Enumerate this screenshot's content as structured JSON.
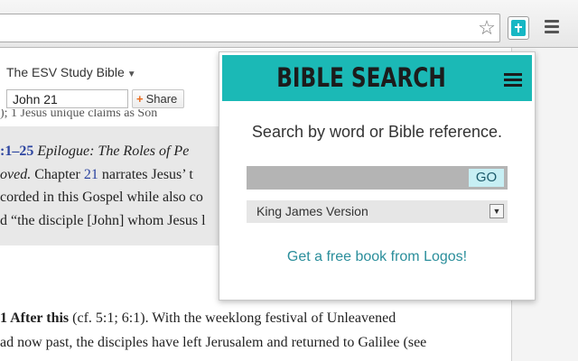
{
  "toolbar": {
    "star_icon": "star-outline-icon",
    "extension_icon": "bible-extension-icon",
    "menu_icon": "hamburger-menu-icon"
  },
  "page": {
    "study_bible": "The ESV Study Bible",
    "reference_value": "John 21",
    "share_label": "Share",
    "cut_line": "); 1   Jesus   unique claims as   Son",
    "lines": [
      {
        "prefix": ":1–25",
        "em": " Epilogue: The Roles of Pe"
      },
      {
        "em": "oved.",
        "rest": " Chapter ",
        "num": "21",
        "rest2": " narrates Jesus’ t"
      },
      {
        "text": "corded in this Gospel while also co"
      },
      {
        "text": "d “the disciple [John] whom Jesus l"
      },
      {
        "bold": "1 After this",
        "text": " (cf. 5:1; 6:1). With the weeklong festival of Unleavened"
      },
      {
        "text": "ad now past, the disciples have left Jerusalem and returned to Galilee (see"
      }
    ]
  },
  "popup": {
    "title": "BIBLE SEARCH",
    "menu_icon": "hamburger-menu-icon",
    "prompt": "Search by word or Bible reference.",
    "search_value": "",
    "go_label": "GO",
    "version": "King James Version",
    "promo": "Get a free book from Logos!"
  },
  "colors": {
    "header": "#1bb9b6",
    "link": "#2a8e9b",
    "go_button": "#c7eff4",
    "scripture_blue": "#2d45a0"
  }
}
